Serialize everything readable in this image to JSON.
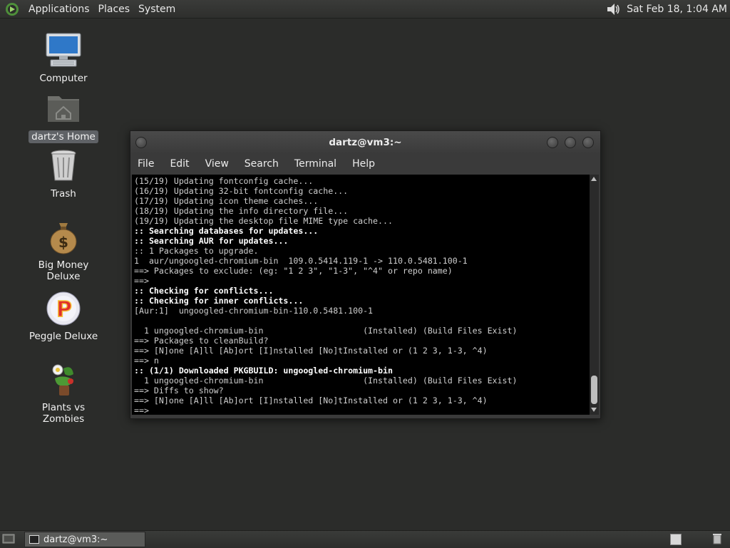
{
  "top_panel": {
    "menus": [
      "Applications",
      "Places",
      "System"
    ],
    "clock": "Sat Feb 18, 1:04 AM",
    "volume_icon": "speaker-icon"
  },
  "desktop_icons": [
    {
      "label": "Computer",
      "icon": "computer-icon"
    },
    {
      "label": "dartz's Home",
      "icon": "home-folder-icon",
      "selected": true
    },
    {
      "label": "Trash",
      "icon": "trash-icon"
    },
    {
      "label": "Big Money Deluxe",
      "icon": "money-bag-icon"
    },
    {
      "label": "Peggle Deluxe",
      "icon": "peggle-icon"
    },
    {
      "label": "Plants vs Zombies",
      "icon": "plants-vs-zombies-icon"
    }
  ],
  "terminal": {
    "title": "dartz@vm3:~",
    "menus": [
      "File",
      "Edit",
      "View",
      "Search",
      "Terminal",
      "Help"
    ],
    "lines": [
      {
        "text": "(15/19) Updating fontconfig cache...",
        "bold": false
      },
      {
        "text": "(16/19) Updating 32-bit fontconfig cache...",
        "bold": false
      },
      {
        "text": "(17/19) Updating icon theme caches...",
        "bold": false
      },
      {
        "text": "(18/19) Updating the info directory file...",
        "bold": false
      },
      {
        "text": "(19/19) Updating the desktop file MIME type cache...",
        "bold": false
      },
      {
        "text": ":: Searching databases for updates...",
        "bold": true
      },
      {
        "text": ":: Searching AUR for updates...",
        "bold": true
      },
      {
        "text": ":: 1 Packages to upgrade.",
        "bold": false
      },
      {
        "text": "1  aur/ungoogled-chromium-bin  109.0.5414.119-1 -> 110.0.5481.100-1",
        "bold": false
      },
      {
        "text": "==> Packages to exclude: (eg: \"1 2 3\", \"1-3\", \"^4\" or repo name)",
        "bold": false
      },
      {
        "text": "==>",
        "bold": false
      },
      {
        "text": ":: Checking for conflicts...",
        "bold": true
      },
      {
        "text": ":: Checking for inner conflicts...",
        "bold": true
      },
      {
        "text": "[Aur:1]  ungoogled-chromium-bin-110.0.5481.100-1",
        "bold": false
      },
      {
        "text": "",
        "bold": false
      },
      {
        "text": "  1 ungoogled-chromium-bin                    (Installed) (Build Files Exist)",
        "bold": false
      },
      {
        "text": "==> Packages to cleanBuild?",
        "bold": false
      },
      {
        "text": "==> [N]one [A]ll [Ab]ort [I]nstalled [No]tInstalled or (1 2 3, 1-3, ^4)",
        "bold": false
      },
      {
        "text": "==> n",
        "bold": false
      },
      {
        "text": ":: (1/1) Downloaded PKGBUILD: ungoogled-chromium-bin",
        "bold": true
      },
      {
        "text": "  1 ungoogled-chromium-bin                    (Installed) (Build Files Exist)",
        "bold": false
      },
      {
        "text": "==> Diffs to show?",
        "bold": false
      },
      {
        "text": "==> [N]one [A]ll [Ab]ort [I]nstalled [No]tInstalled or (1 2 3, 1-3, ^4)",
        "bold": false
      },
      {
        "text": "==>",
        "bold": false
      }
    ]
  },
  "bottom_panel": {
    "task_label": "dartz@vm3:~"
  }
}
